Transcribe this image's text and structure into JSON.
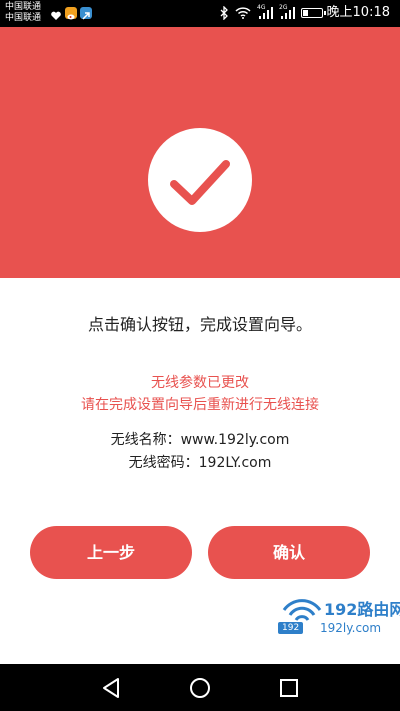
{
  "status_bar": {
    "carrier_1": "中国联通",
    "carrier_2": "中国联通",
    "signal_1_label": "4G",
    "signal_2_label": "2G",
    "time": "晚上10:18"
  },
  "banner": {
    "color": "#e8524f",
    "icon": "checkmark-icon"
  },
  "content": {
    "instruction": "点击确认按钮，完成设置向导。",
    "warning_title": "无线参数已更改",
    "warning_detail": "请在完成设置向导后重新进行无线连接",
    "ssid_line": "无线名称：www.192ly.com",
    "password_line": "无线密码：192LY.com"
  },
  "buttons": {
    "prev_label": "上一步",
    "confirm_label": "确认"
  },
  "watermark": {
    "title": "192路由网",
    "badge": "192",
    "url": "192ly.com"
  },
  "nav_bar": {
    "back_icon": "back-triangle-icon",
    "home_icon": "home-circle-icon",
    "recents_icon": "recents-square-icon"
  }
}
